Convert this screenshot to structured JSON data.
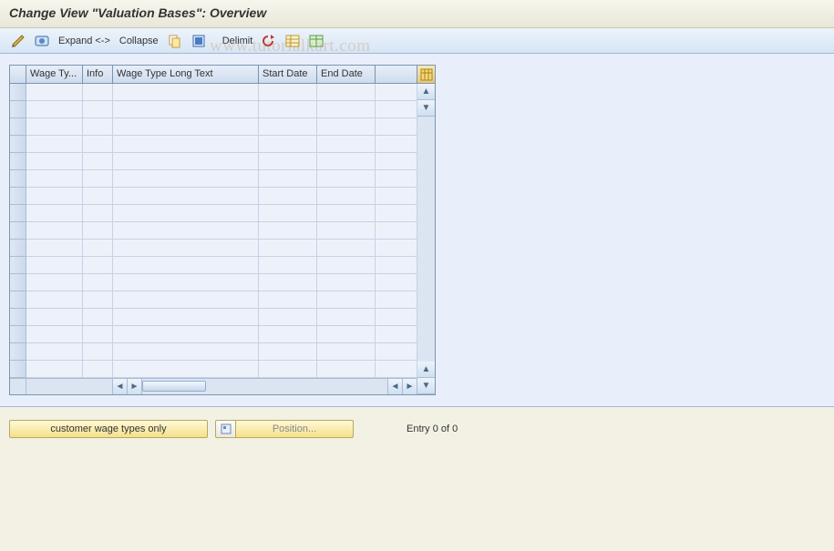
{
  "title": "Change View \"Valuation Bases\": Overview",
  "toolbar": {
    "expand": "Expand <->",
    "collapse": "Collapse",
    "delimit": "Delimit"
  },
  "columns": {
    "wage_type": "Wage Ty...",
    "info": "Info",
    "long_text": "Wage Type Long Text",
    "start_date": "Start Date",
    "end_date": "End Date"
  },
  "footer": {
    "customer_btn": "customer wage types only",
    "position_btn": "Position...",
    "entry_text": "Entry 0 of 0"
  },
  "watermark": "www.tutorialkart.com"
}
